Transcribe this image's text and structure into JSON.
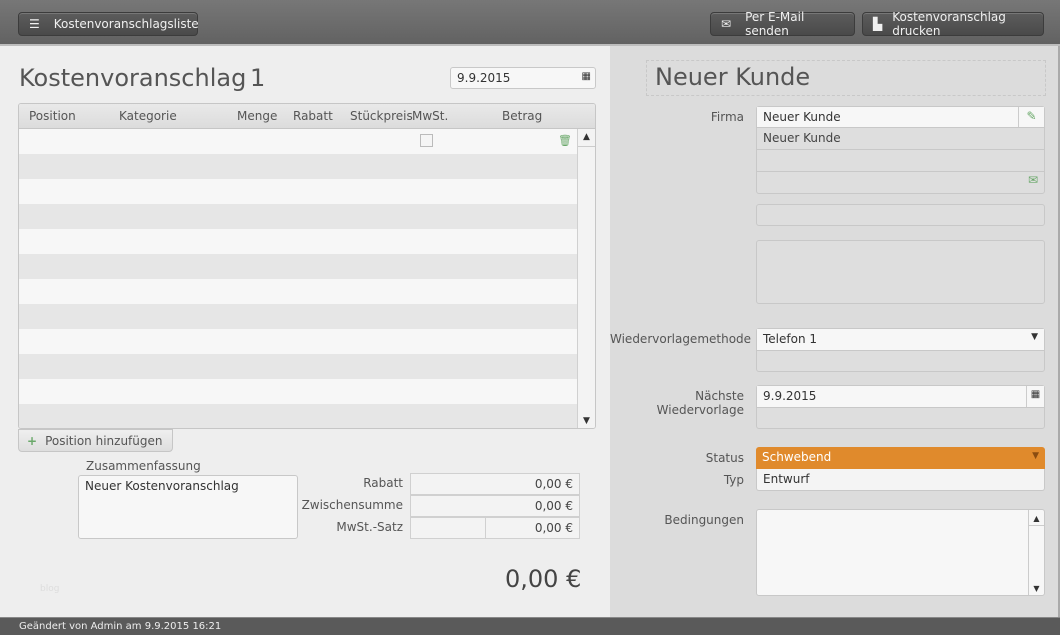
{
  "toolbar": {
    "list_button": "Kostenvoranschlagsliste",
    "email_button": "Per E-Mail senden",
    "print_button": "Kostenvoranschlag drucken"
  },
  "quote": {
    "title": "Kostenvoranschlag",
    "number": "1",
    "date": "9.9.2015"
  },
  "table": {
    "columns": [
      "Position",
      "Kategorie",
      "Menge",
      "Rabatt",
      "Stückpreis",
      "MwSt.",
      "Betrag"
    ],
    "row_count": 12
  },
  "add_position": "Position hinzufügen",
  "summary": {
    "label": "Zusammenfassung",
    "value": "Neuer Kostenvoranschlag"
  },
  "totals": {
    "rabatt_label": "Rabatt",
    "rabatt": "0,00 €",
    "zwischensumme_label": "Zwischensumme",
    "zwischensumme": "0,00 €",
    "mwst_label": "MwSt.-Satz",
    "mwst": "0,00 €",
    "total": "0,00 €"
  },
  "watermark": "blog",
  "customer": {
    "title": "Neuer Kunde",
    "firma_label": "Firma",
    "firma": "Neuer Kunde",
    "firma_line2": "Neuer Kunde"
  },
  "followup": {
    "method_label": "Wiedervorlagemethode",
    "method": "Telefon 1",
    "next_label": "Nächste Wiedervorlage",
    "next": "9.9.2015"
  },
  "status": {
    "label": "Status",
    "value": "Schwebend",
    "color": "#e08a2c",
    "typ_label": "Typ",
    "typ": "Entwurf"
  },
  "conditions": {
    "label": "Bedingungen",
    "value": ""
  },
  "footer": "Geändert von Admin am 9.9.2015 16:21"
}
